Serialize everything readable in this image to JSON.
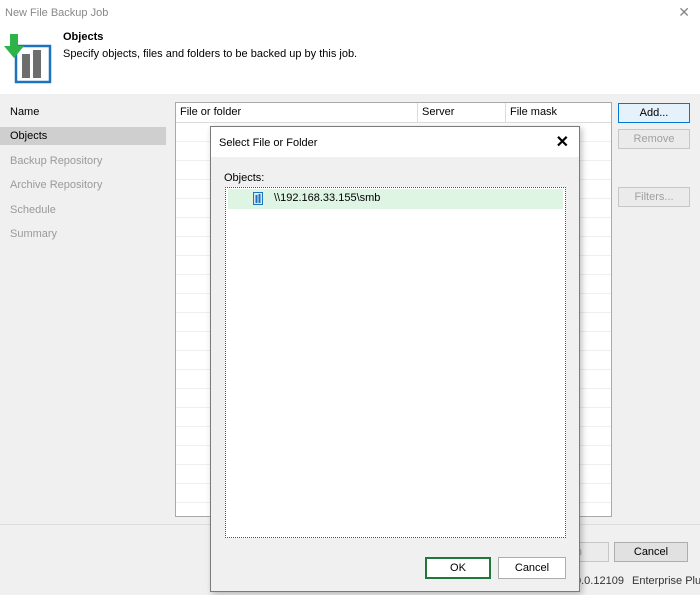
{
  "window": {
    "title": "New File Backup Job",
    "close_glyph": "✕"
  },
  "header": {
    "title": "Objects",
    "description": "Specify objects, files and folders to be backed up by this job.",
    "icon": "backup-job-icon"
  },
  "nav": {
    "items": [
      {
        "label": "Name",
        "state": "normal"
      },
      {
        "label": "Objects",
        "state": "active"
      },
      {
        "label": "Backup Repository",
        "state": "disabled"
      },
      {
        "label": "Archive Repository",
        "state": "disabled"
      },
      {
        "label": "Schedule",
        "state": "disabled"
      },
      {
        "label": "Summary",
        "state": "disabled"
      }
    ]
  },
  "table": {
    "columns": [
      "File or folder",
      "Server",
      "File mask"
    ]
  },
  "side_buttons": {
    "add": "Add...",
    "remove": "Remove",
    "filters": "Filters..."
  },
  "footer": {
    "cancel": "Cancel",
    "finish_partial": "h",
    "version_partial": "0.0.12109",
    "edition_partial": "Enterprise Plus f"
  },
  "dialog": {
    "title": "Select File or Folder",
    "close_glyph": "✕",
    "objects_label": "Objects:",
    "items": [
      {
        "label": "\\\\192.168.33.155\\smb",
        "icon": "share-icon"
      }
    ],
    "ok": "OK",
    "cancel": "Cancel"
  },
  "colors": {
    "selected_row": "#dff5e3",
    "ok_border": "#1f7a3a",
    "nav_active": "#cfcfcf",
    "accent_green": "#2eb34a",
    "icon_blue": "#1e73be"
  }
}
